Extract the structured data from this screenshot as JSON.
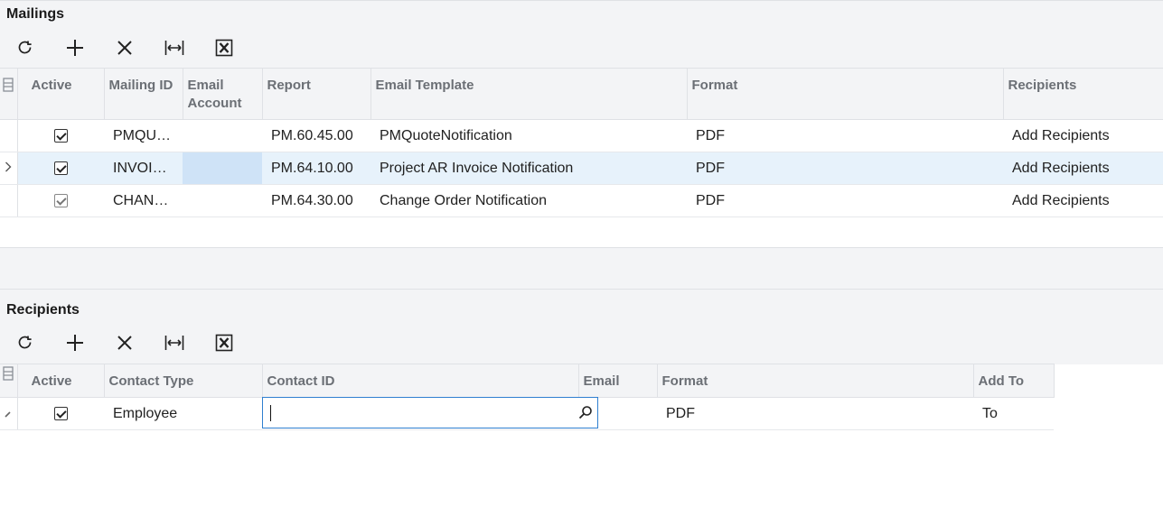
{
  "mailings": {
    "title": "Mailings",
    "toolbar": [
      "refresh-icon",
      "add-icon",
      "delete-icon",
      "fit-columns-icon",
      "export-excel-icon"
    ],
    "columns": {
      "active": "Active",
      "mailing_id": "Mailing ID",
      "email_account": "Email Account",
      "report": "Report",
      "email_template": "Email Template",
      "format": "Format",
      "recipients": "Recipients"
    },
    "rows": [
      {
        "active": true,
        "mailing_id": "PMQU…",
        "email_account": "",
        "report": "PM.60.45.00",
        "email_template": "PMQuoteNotification",
        "format": "PDF",
        "recipients": "Add Recipients"
      },
      {
        "active": true,
        "mailing_id": "INVOI…",
        "email_account": "",
        "report": "PM.64.10.00",
        "email_template": "Project AR Invoice Notification",
        "format": "PDF",
        "recipients": "Add Recipients"
      },
      {
        "active": true,
        "mailing_id": "CHAN…",
        "email_account": "",
        "report": "PM.64.30.00",
        "email_template": "Change Order Notification",
        "format": "PDF",
        "recipients": "Add Recipients"
      }
    ],
    "selected_row": 1
  },
  "recipients": {
    "title": "Recipients",
    "columns": {
      "active": "Active",
      "contact_type": "Contact Type",
      "contact_id": "Contact ID",
      "email": "Email",
      "format": "Format",
      "add_to": "Add To"
    },
    "rows": [
      {
        "active": true,
        "contact_type": "Employee",
        "contact_id": "",
        "email": "",
        "format": "PDF",
        "add_to": "To"
      }
    ]
  },
  "colors": {
    "accent": "#2f7fd0",
    "header_bg": "#f3f4f6",
    "selected_row": "#e7f2fb"
  }
}
